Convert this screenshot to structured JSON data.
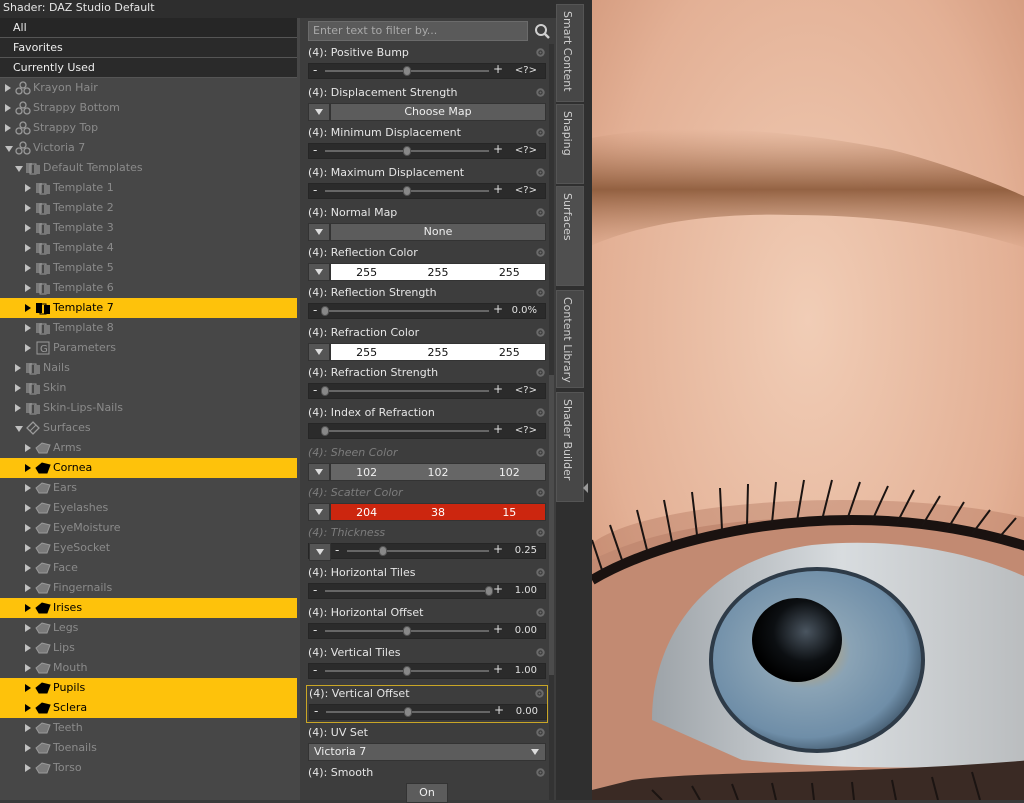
{
  "window": {
    "title": "Shader: DAZ Studio Default"
  },
  "categories": [
    "All",
    "Favorites",
    "Currently Used"
  ],
  "tree": [
    {
      "label": "Krayon Hair",
      "indent": 0,
      "expanded": false,
      "icon": "figure-icon",
      "dim": true,
      "selected": false
    },
    {
      "label": "Strappy Bottom",
      "indent": 0,
      "expanded": false,
      "icon": "figure-icon",
      "dim": true,
      "selected": false
    },
    {
      "label": "Strappy Top",
      "indent": 0,
      "expanded": false,
      "icon": "figure-icon",
      "dim": true,
      "selected": false
    },
    {
      "label": "Victoria 7",
      "indent": 0,
      "expanded": true,
      "icon": "figure-icon",
      "dim": true,
      "selected": false
    },
    {
      "label": "Default Templates",
      "indent": 1,
      "expanded": true,
      "icon": "templates-icon",
      "dim": true,
      "selected": false
    },
    {
      "label": "Template 1",
      "indent": 2,
      "expanded": false,
      "icon": "template-icon",
      "dim": true,
      "selected": false
    },
    {
      "label": "Template 2",
      "indent": 2,
      "expanded": false,
      "icon": "template-icon",
      "dim": true,
      "selected": false
    },
    {
      "label": "Template 3",
      "indent": 2,
      "expanded": false,
      "icon": "template-icon",
      "dim": true,
      "selected": false
    },
    {
      "label": "Template 4",
      "indent": 2,
      "expanded": false,
      "icon": "template-icon",
      "dim": true,
      "selected": false
    },
    {
      "label": "Template 5",
      "indent": 2,
      "expanded": false,
      "icon": "template-icon",
      "dim": true,
      "selected": false
    },
    {
      "label": "Template 6",
      "indent": 2,
      "expanded": false,
      "icon": "template-icon",
      "dim": true,
      "selected": false
    },
    {
      "label": "Template 7",
      "indent": 2,
      "expanded": false,
      "icon": "template-icon",
      "dim": false,
      "selected": true
    },
    {
      "label": "Template 8",
      "indent": 2,
      "expanded": false,
      "icon": "template-icon",
      "dim": true,
      "selected": false
    },
    {
      "label": "Parameters",
      "indent": 2,
      "expanded": false,
      "icon": "parameters-icon",
      "dim": true,
      "selected": false
    },
    {
      "label": "Nails",
      "indent": 1,
      "expanded": false,
      "icon": "templates-icon",
      "dim": true,
      "selected": false
    },
    {
      "label": "Skin",
      "indent": 1,
      "expanded": false,
      "icon": "templates-icon",
      "dim": true,
      "selected": false
    },
    {
      "label": "Skin-Lips-Nails",
      "indent": 1,
      "expanded": false,
      "icon": "templates-icon",
      "dim": true,
      "selected": false
    },
    {
      "label": "Surfaces",
      "indent": 1,
      "expanded": true,
      "icon": "surfaces-icon",
      "dim": true,
      "selected": false
    },
    {
      "label": "Arms",
      "indent": 2,
      "expanded": false,
      "icon": "surface-icon",
      "dim": true,
      "selected": false
    },
    {
      "label": "Cornea",
      "indent": 2,
      "expanded": false,
      "icon": "surface-icon",
      "dim": false,
      "selected": true
    },
    {
      "label": "Ears",
      "indent": 2,
      "expanded": false,
      "icon": "surface-icon",
      "dim": true,
      "selected": false
    },
    {
      "label": "Eyelashes",
      "indent": 2,
      "expanded": false,
      "icon": "surface-icon",
      "dim": true,
      "selected": false
    },
    {
      "label": "EyeMoisture",
      "indent": 2,
      "expanded": false,
      "icon": "surface-icon",
      "dim": true,
      "selected": false
    },
    {
      "label": "EyeSocket",
      "indent": 2,
      "expanded": false,
      "icon": "surface-icon",
      "dim": true,
      "selected": false
    },
    {
      "label": "Face",
      "indent": 2,
      "expanded": false,
      "icon": "surface-icon",
      "dim": true,
      "selected": false
    },
    {
      "label": "Fingernails",
      "indent": 2,
      "expanded": false,
      "icon": "surface-icon",
      "dim": true,
      "selected": false
    },
    {
      "label": "Irises",
      "indent": 2,
      "expanded": false,
      "icon": "surface-icon",
      "dim": false,
      "selected": true
    },
    {
      "label": "Legs",
      "indent": 2,
      "expanded": false,
      "icon": "surface-icon",
      "dim": true,
      "selected": false
    },
    {
      "label": "Lips",
      "indent": 2,
      "expanded": false,
      "icon": "surface-icon",
      "dim": true,
      "selected": false
    },
    {
      "label": "Mouth",
      "indent": 2,
      "expanded": false,
      "icon": "surface-icon",
      "dim": true,
      "selected": false
    },
    {
      "label": "Pupils",
      "indent": 2,
      "expanded": false,
      "icon": "surface-icon",
      "dim": false,
      "selected": true
    },
    {
      "label": "Sclera",
      "indent": 2,
      "expanded": false,
      "icon": "surface-icon",
      "dim": false,
      "selected": true
    },
    {
      "label": "Teeth",
      "indent": 2,
      "expanded": false,
      "icon": "surface-icon",
      "dim": true,
      "selected": false
    },
    {
      "label": "Toenails",
      "indent": 2,
      "expanded": false,
      "icon": "surface-icon",
      "dim": true,
      "selected": false
    },
    {
      "label": "Torso",
      "indent": 2,
      "expanded": false,
      "icon": "surface-icon",
      "dim": true,
      "selected": false
    }
  ],
  "filter": {
    "placeholder": "Enter text to filter by..."
  },
  "properties": [
    {
      "label": "(4): Positive Bump",
      "control": "slider",
      "level": 0.5,
      "value": "<?>",
      "dim": false
    },
    {
      "label": "(4): Displacement Strength",
      "control": "map",
      "button": "Choose Map",
      "dim": false
    },
    {
      "label": "(4): Minimum Displacement",
      "control": "slider",
      "level": 0.5,
      "value": "<?>",
      "dim": false
    },
    {
      "label": "(4): Maximum Displacement",
      "control": "slider",
      "level": 0.5,
      "value": "<?>",
      "dim": false
    },
    {
      "label": "(4): Normal Map",
      "control": "map",
      "button": "None",
      "dim": false
    },
    {
      "label": "(4): Reflection Color",
      "control": "color",
      "rgb": [
        "255",
        "255",
        "255"
      ],
      "bg": "#ffffff",
      "fg": "#111111",
      "dim": false
    },
    {
      "label": "(4): Reflection Strength",
      "control": "slider",
      "level": 0.0,
      "value": "0.0%",
      "dim": false
    },
    {
      "label": "(4): Refraction Color",
      "control": "color",
      "rgb": [
        "255",
        "255",
        "255"
      ],
      "bg": "#ffffff",
      "fg": "#111111",
      "dim": false
    },
    {
      "label": "(4): Refraction Strength",
      "control": "slider",
      "level": 0.0,
      "value": "<?>",
      "dim": false
    },
    {
      "label": "(4): Index of Refraction",
      "control": "slider",
      "level": 0.0,
      "value": "<?>",
      "dim": false,
      "noMinus": true
    },
    {
      "label": "(4): Sheen Color",
      "control": "color",
      "rgb": [
        "102",
        "102",
        "102"
      ],
      "bg": "#666666",
      "fg": "#f0f0f0",
      "dim": true
    },
    {
      "label": "(4): Scatter Color",
      "control": "color",
      "rgb": [
        "204",
        "38",
        "15"
      ],
      "bg": "#cc260f",
      "fg": "#ffffff",
      "dim": true
    },
    {
      "label": "(4): Thickness",
      "control": "slider",
      "level": 0.25,
      "value": "0.25",
      "dim": true,
      "withDrop": true
    },
    {
      "label": "(4): Horizontal Tiles",
      "control": "slider",
      "level": 1.0,
      "value": "1.00",
      "dim": false
    },
    {
      "label": "(4): Horizontal Offset",
      "control": "slider",
      "level": 0.5,
      "value": "0.00",
      "dim": false
    },
    {
      "label": "(4): Vertical Tiles",
      "control": "slider",
      "level": 0.5,
      "value": "1.00",
      "dim": false
    },
    {
      "label": "(4): Vertical Offset",
      "control": "slider",
      "level": 0.5,
      "value": "0.00",
      "dim": false,
      "highlight": true
    },
    {
      "label": "(4): UV Set",
      "control": "select",
      "value": "Victoria 7",
      "dim": false
    },
    {
      "label": "(4): Smooth",
      "control": "toggle",
      "value": "On",
      "dim": false
    }
  ],
  "tabs": [
    {
      "label": "Smart Content",
      "active": false
    },
    {
      "label": "Shaping",
      "active": false
    },
    {
      "label": "Surfaces",
      "active": true
    },
    {
      "label": "Content Library",
      "active": false
    },
    {
      "label": "Shader Builder",
      "active": false
    }
  ],
  "colors": {
    "selection": "#fec20b",
    "highlight": "#c9a626",
    "panel": "#474747"
  }
}
